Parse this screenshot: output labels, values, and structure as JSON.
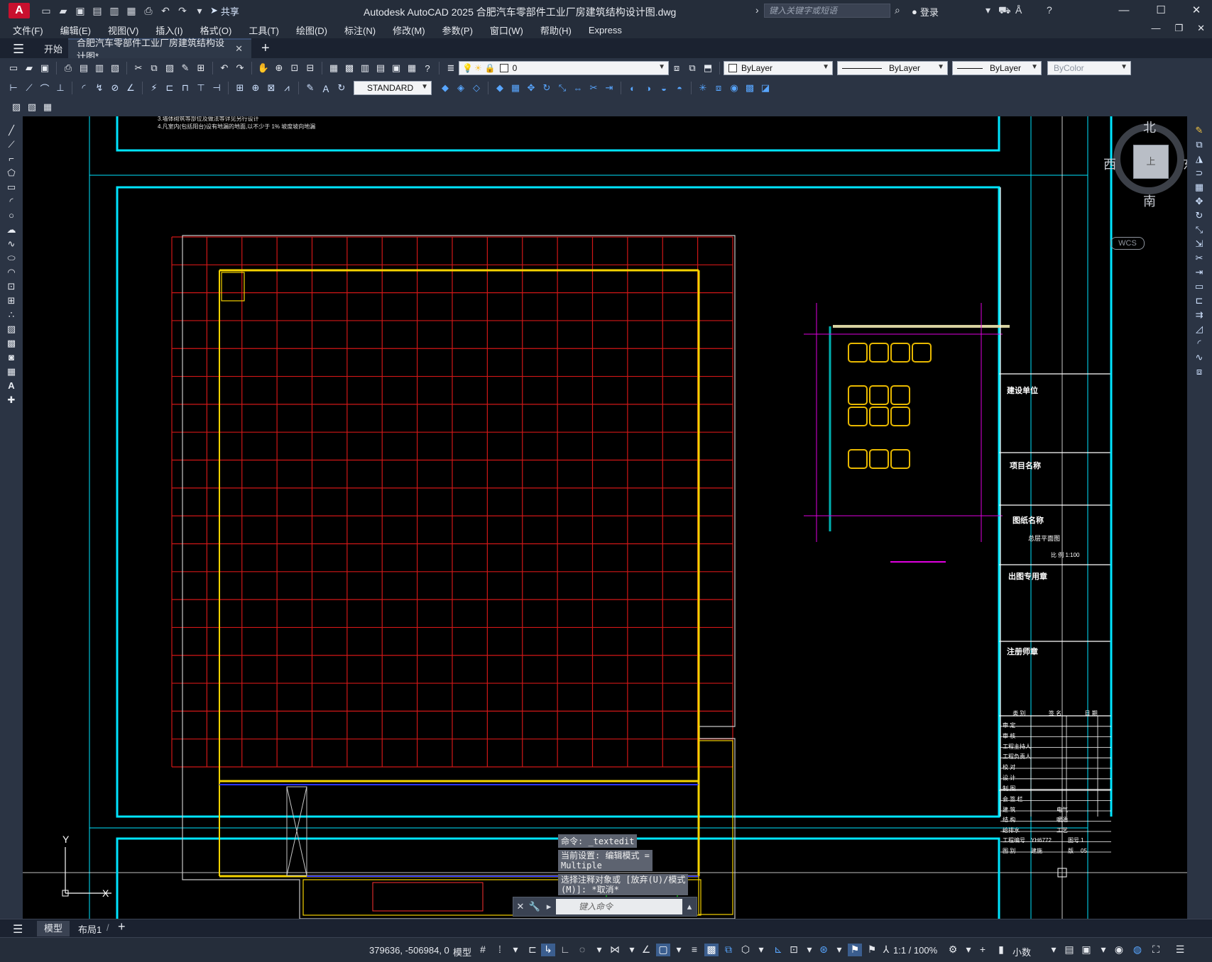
{
  "app": {
    "title": "Autodesk AutoCAD 2025    合肥汽车零部件工业厂房建筑结构设计图.dwg",
    "logo": "A",
    "share_label": "共享",
    "search_placeholder": "键入关键字或短语",
    "login_label": "登录"
  },
  "menu": [
    "文件(F)",
    "编辑(E)",
    "视图(V)",
    "插入(I)",
    "格式(O)",
    "工具(T)",
    "绘图(D)",
    "标注(N)",
    "修改(M)",
    "参数(P)",
    "窗口(W)",
    "帮助(H)",
    "Express"
  ],
  "tabs": {
    "start": "开始",
    "doc": "合肥汽车零部件工业厂房建筑结构设计图*"
  },
  "toolbar": {
    "layer_value": "0",
    "text_style": "STANDARD",
    "color": "ByLayer",
    "linetype": "ByLayer",
    "lineweight": "ByLayer",
    "plotstyle": "ByColor"
  },
  "viewcube": {
    "north": "北",
    "south": "南",
    "east": "东",
    "west": "西",
    "face": "上",
    "wcs": "WCS"
  },
  "drawing": {
    "notes": [
      "3.墙体砌筑等部位及做法等详见另行设计",
      "4.凡室内(包括阳台)设有地漏的地面,以不少于 1%  坡度坡向地漏"
    ],
    "title_block": {
      "construction_unit": "建设单位",
      "project_name": "项目名称",
      "drawing_name": "图纸名称",
      "drawing_title": "总层平面图",
      "scale": "比 例   1:100",
      "seal_outgoing": "出图专用章",
      "seal_registered": "注册师章",
      "table_header": [
        "类 别",
        "签 名",
        "日 期"
      ],
      "roles": [
        "审 定",
        "审 核",
        "工程主持人",
        "工程负责人",
        "校 对",
        "设 计",
        "制 图"
      ],
      "bottom_rows": [
        {
          "a": "会 签 栏",
          "b": "",
          "c": ""
        },
        {
          "a": "建 筑",
          "b": "电气",
          "c": ""
        },
        {
          "a": "结 构",
          "b": "暖通",
          "c": ""
        },
        {
          "a": "给排水",
          "b": "工艺",
          "c": ""
        },
        {
          "a": "工程编号",
          "b": "YH6772",
          "c": "图号",
          "d": "1"
        },
        {
          "a": "图 别",
          "b": "建施",
          "c": "版",
          "d": "05"
        }
      ]
    }
  },
  "command": {
    "history": [
      "命令: _textedit",
      "当前设置: 编辑模式 =\nMultiple",
      "选择注释对象或 [放弃(U)/模式\n(M)]: *取消*"
    ],
    "placeholder": "键入命令"
  },
  "layouts": {
    "model": "模型",
    "layout1": "布局1"
  },
  "status": {
    "coords": "379636, -506984, 0",
    "model": "模型",
    "scale": "1:1 / 100%",
    "units": "小数"
  },
  "colors": {
    "frame": "#00e5ff",
    "grid": "#d01717",
    "wall": "#f5d300",
    "outline": "#c8c8c8",
    "magenta": "#e100e1",
    "green": "#00e000"
  }
}
